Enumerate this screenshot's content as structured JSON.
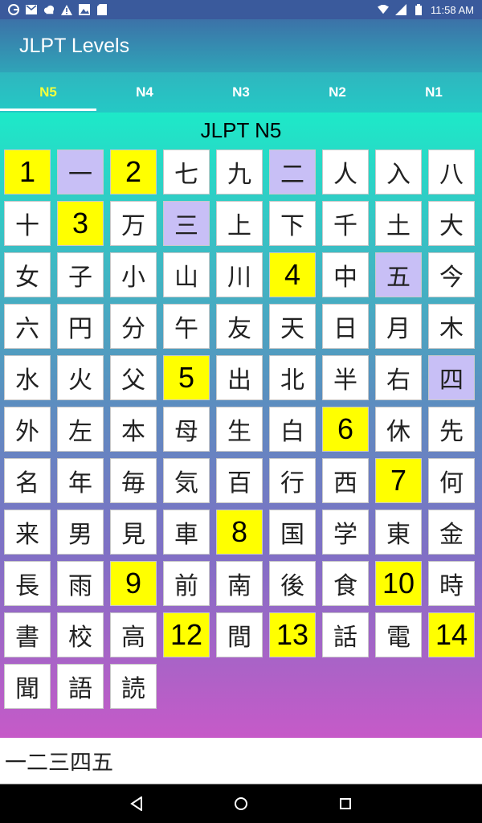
{
  "status_bar": {
    "time": "11:58 AM",
    "icons_left": [
      "google-icon",
      "gmail-icon",
      "cloud-icon",
      "warning-icon",
      "image-icon",
      "sd-card-icon"
    ],
    "icons_right": [
      "wifi-icon",
      "signal-icon",
      "battery-icon"
    ]
  },
  "app_bar": {
    "title": "JLPT Levels"
  },
  "tabs": [
    {
      "label": "N5",
      "active": true
    },
    {
      "label": "N4",
      "active": false
    },
    {
      "label": "N3",
      "active": false
    },
    {
      "label": "N2",
      "active": false
    },
    {
      "label": "N1",
      "active": false
    }
  ],
  "content": {
    "level_title": "JLPT N5",
    "cells": [
      {
        "text": "1",
        "type": "marker"
      },
      {
        "text": "一",
        "type": "num"
      },
      {
        "text": "2",
        "type": "marker"
      },
      {
        "text": "七",
        "type": "kanji"
      },
      {
        "text": "九",
        "type": "kanji"
      },
      {
        "text": "二",
        "type": "num"
      },
      {
        "text": "人",
        "type": "kanji"
      },
      {
        "text": "入",
        "type": "kanji"
      },
      {
        "text": "八",
        "type": "kanji"
      },
      {
        "text": "十",
        "type": "kanji"
      },
      {
        "text": "3",
        "type": "marker"
      },
      {
        "text": "万",
        "type": "kanji"
      },
      {
        "text": "三",
        "type": "num"
      },
      {
        "text": "上",
        "type": "kanji"
      },
      {
        "text": "下",
        "type": "kanji"
      },
      {
        "text": "千",
        "type": "kanji"
      },
      {
        "text": "土",
        "type": "kanji"
      },
      {
        "text": "大",
        "type": "kanji"
      },
      {
        "text": "女",
        "type": "kanji"
      },
      {
        "text": "子",
        "type": "kanji"
      },
      {
        "text": "小",
        "type": "kanji"
      },
      {
        "text": "山",
        "type": "kanji"
      },
      {
        "text": "川",
        "type": "kanji"
      },
      {
        "text": "4",
        "type": "marker"
      },
      {
        "text": "中",
        "type": "kanji"
      },
      {
        "text": "五",
        "type": "num"
      },
      {
        "text": "今",
        "type": "kanji"
      },
      {
        "text": "六",
        "type": "kanji"
      },
      {
        "text": "円",
        "type": "kanji"
      },
      {
        "text": "分",
        "type": "kanji"
      },
      {
        "text": "午",
        "type": "kanji"
      },
      {
        "text": "友",
        "type": "kanji"
      },
      {
        "text": "天",
        "type": "kanji"
      },
      {
        "text": "日",
        "type": "kanji"
      },
      {
        "text": "月",
        "type": "kanji"
      },
      {
        "text": "木",
        "type": "kanji"
      },
      {
        "text": "水",
        "type": "kanji"
      },
      {
        "text": "火",
        "type": "kanji"
      },
      {
        "text": "父",
        "type": "kanji"
      },
      {
        "text": "5",
        "type": "marker"
      },
      {
        "text": "出",
        "type": "kanji"
      },
      {
        "text": "北",
        "type": "kanji"
      },
      {
        "text": "半",
        "type": "kanji"
      },
      {
        "text": "右",
        "type": "kanji"
      },
      {
        "text": "四",
        "type": "num"
      },
      {
        "text": "外",
        "type": "kanji"
      },
      {
        "text": "左",
        "type": "kanji"
      },
      {
        "text": "本",
        "type": "kanji"
      },
      {
        "text": "母",
        "type": "kanji"
      },
      {
        "text": "生",
        "type": "kanji"
      },
      {
        "text": "白",
        "type": "kanji"
      },
      {
        "text": "6",
        "type": "marker"
      },
      {
        "text": "休",
        "type": "kanji"
      },
      {
        "text": "先",
        "type": "kanji"
      },
      {
        "text": "名",
        "type": "kanji"
      },
      {
        "text": "年",
        "type": "kanji"
      },
      {
        "text": "毎",
        "type": "kanji"
      },
      {
        "text": "気",
        "type": "kanji"
      },
      {
        "text": "百",
        "type": "kanji"
      },
      {
        "text": "行",
        "type": "kanji"
      },
      {
        "text": "西",
        "type": "kanji"
      },
      {
        "text": "7",
        "type": "marker"
      },
      {
        "text": "何",
        "type": "kanji"
      },
      {
        "text": "来",
        "type": "kanji"
      },
      {
        "text": "男",
        "type": "kanji"
      },
      {
        "text": "見",
        "type": "kanji"
      },
      {
        "text": "車",
        "type": "kanji"
      },
      {
        "text": "8",
        "type": "marker"
      },
      {
        "text": "国",
        "type": "kanji"
      },
      {
        "text": "学",
        "type": "kanji"
      },
      {
        "text": "東",
        "type": "kanji"
      },
      {
        "text": "金",
        "type": "kanji"
      },
      {
        "text": "長",
        "type": "kanji"
      },
      {
        "text": "雨",
        "type": "kanji"
      },
      {
        "text": "9",
        "type": "marker"
      },
      {
        "text": "前",
        "type": "kanji"
      },
      {
        "text": "南",
        "type": "kanji"
      },
      {
        "text": "後",
        "type": "kanji"
      },
      {
        "text": "食",
        "type": "kanji"
      },
      {
        "text": "10",
        "type": "marker"
      },
      {
        "text": "時",
        "type": "kanji"
      },
      {
        "text": "書",
        "type": "kanji"
      },
      {
        "text": "校",
        "type": "kanji"
      },
      {
        "text": "高",
        "type": "kanji"
      },
      {
        "text": "12",
        "type": "marker"
      },
      {
        "text": "間",
        "type": "kanji"
      },
      {
        "text": "13",
        "type": "marker"
      },
      {
        "text": "話",
        "type": "kanji"
      },
      {
        "text": "電",
        "type": "kanji"
      },
      {
        "text": "14",
        "type": "marker"
      },
      {
        "text": "聞",
        "type": "kanji"
      },
      {
        "text": "語",
        "type": "kanji"
      },
      {
        "text": "読",
        "type": "kanji"
      }
    ]
  },
  "selection": {
    "text": "一二三四五"
  },
  "nav_bar": {
    "icons": [
      "back-icon",
      "home-icon",
      "recents-icon"
    ]
  },
  "colors": {
    "marker": "#ffff00",
    "highlight": "#c8bff6",
    "active_tab": "#f4ff3c"
  }
}
